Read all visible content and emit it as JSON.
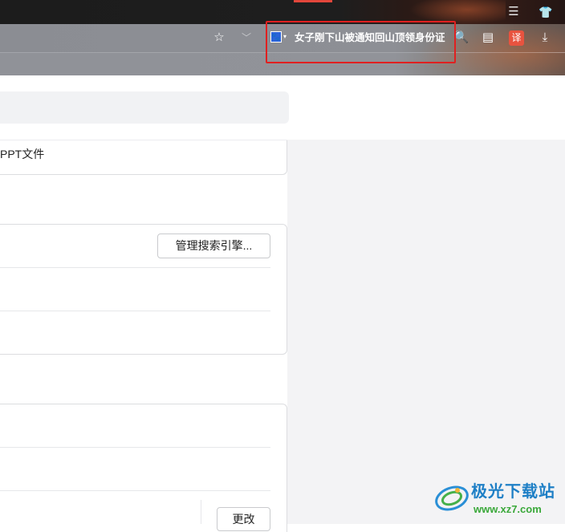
{
  "titlebar": {
    "menu_icon": "hamburger-icon",
    "skin_icon": "tshirt-icon",
    "menu_glyph": "☰",
    "skin_glyph": "👕"
  },
  "toolbar": {
    "favorite_icon": "star-icon",
    "favorite_glyph": "☆",
    "dropdown_glyph": "﹀",
    "search_engine_icon": "baidu-paw-icon",
    "search_engine_glyph": "🐾",
    "engine_caret_glyph": "▾",
    "search_text": "女子刚下山被通知回山顶领身份证",
    "search_glyph": "🔍",
    "notes_glyph": "▤",
    "translate_label": "译",
    "download_glyph": "⤓",
    "ext_glyph": "▕"
  },
  "settings": {
    "card1_text": "PPT文件",
    "manage_engines_label": "管理搜索引擎...",
    "change_label": "更改"
  },
  "watermark": {
    "title": "极光下载站",
    "url": "www.xz7.com"
  },
  "colors": {
    "highlight": "#e02020",
    "translate": "#e8533f",
    "accent_blue": "#1e7fc6",
    "accent_green": "#3aa83a"
  }
}
